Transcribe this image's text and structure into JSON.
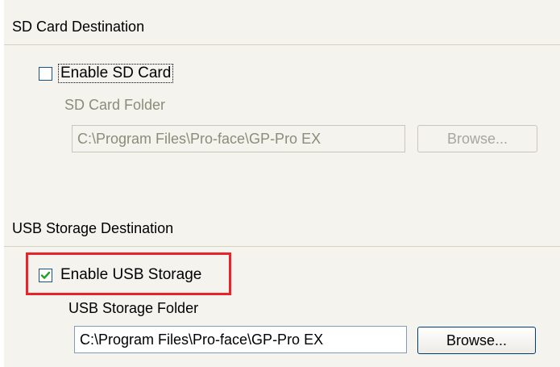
{
  "sd_section": {
    "title": "SD Card Destination",
    "enable_label": "Enable SD Card",
    "enabled": false,
    "folder_label": "SD Card Folder",
    "folder_value": "C:\\Program Files\\Pro-face\\GP-Pro EX",
    "browse_label": "Browse..."
  },
  "usb_section": {
    "title": "USB Storage Destination",
    "enable_label": "Enable USB Storage",
    "enabled": true,
    "folder_label": "USB Storage Folder",
    "folder_value": "C:\\Program Files\\Pro-face\\GP-Pro EX",
    "browse_label": "Browse..."
  },
  "colors": {
    "highlight": "#e8232a",
    "checkmark": "#21a121",
    "panel_bg": "#f4f3ee"
  },
  "icons": {
    "checked": "checkmark-icon"
  }
}
